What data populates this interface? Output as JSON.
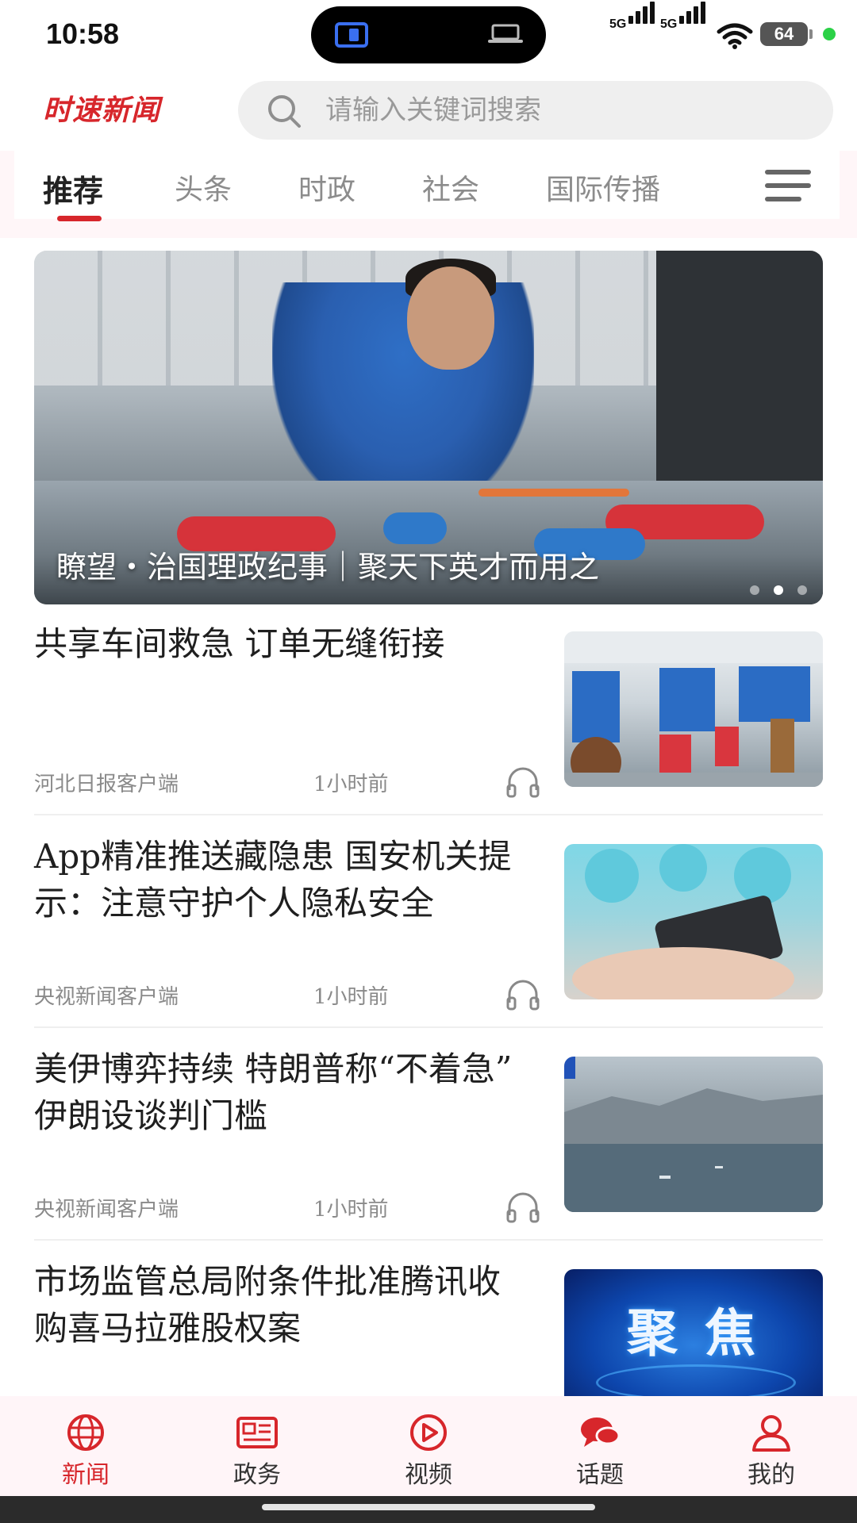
{
  "status_bar": {
    "time": "10:58",
    "network1": "5G",
    "network2": "5G",
    "battery": "64"
  },
  "header": {
    "logo": "时速新闻",
    "search_placeholder": "请输入关键词搜索"
  },
  "tabs": [
    {
      "label": "推荐",
      "active": true
    },
    {
      "label": "头条",
      "active": false
    },
    {
      "label": "时政",
      "active": false
    },
    {
      "label": "社会",
      "active": false
    },
    {
      "label": "国际传播",
      "active": false
    }
  ],
  "banner": {
    "caption": "瞭望・治国理政纪事｜聚天下英才而用之"
  },
  "news": [
    {
      "title": "共享车间救急  订单无缝衔接",
      "source": "河北日报客户端",
      "time": "1小时前"
    },
    {
      "title": "App精准推送藏隐患  国安机关提示：注意守护个人隐私安全",
      "source": "央视新闻客户端",
      "time": "1小时前"
    },
    {
      "title": "美伊博弈持续  特朗普称“不着急”  伊朗设谈判门槛",
      "source": "央视新闻客户端",
      "time": "1小时前"
    },
    {
      "title": "市场监管总局附条件批准腾讯收购喜马拉雅股权案",
      "source": "",
      "time": ""
    }
  ],
  "thumb_texts": {
    "thumb4": "聚 焦"
  },
  "bottom_nav": [
    {
      "label": "新闻",
      "active": true
    },
    {
      "label": "政务",
      "active": false
    },
    {
      "label": "视频",
      "active": false
    },
    {
      "label": "话题",
      "active": false
    },
    {
      "label": "我的",
      "active": false
    }
  ],
  "colors": {
    "accent": "#d7262b",
    "tab_band": "#fff6f8",
    "nav_bg": "#fff5f8"
  }
}
